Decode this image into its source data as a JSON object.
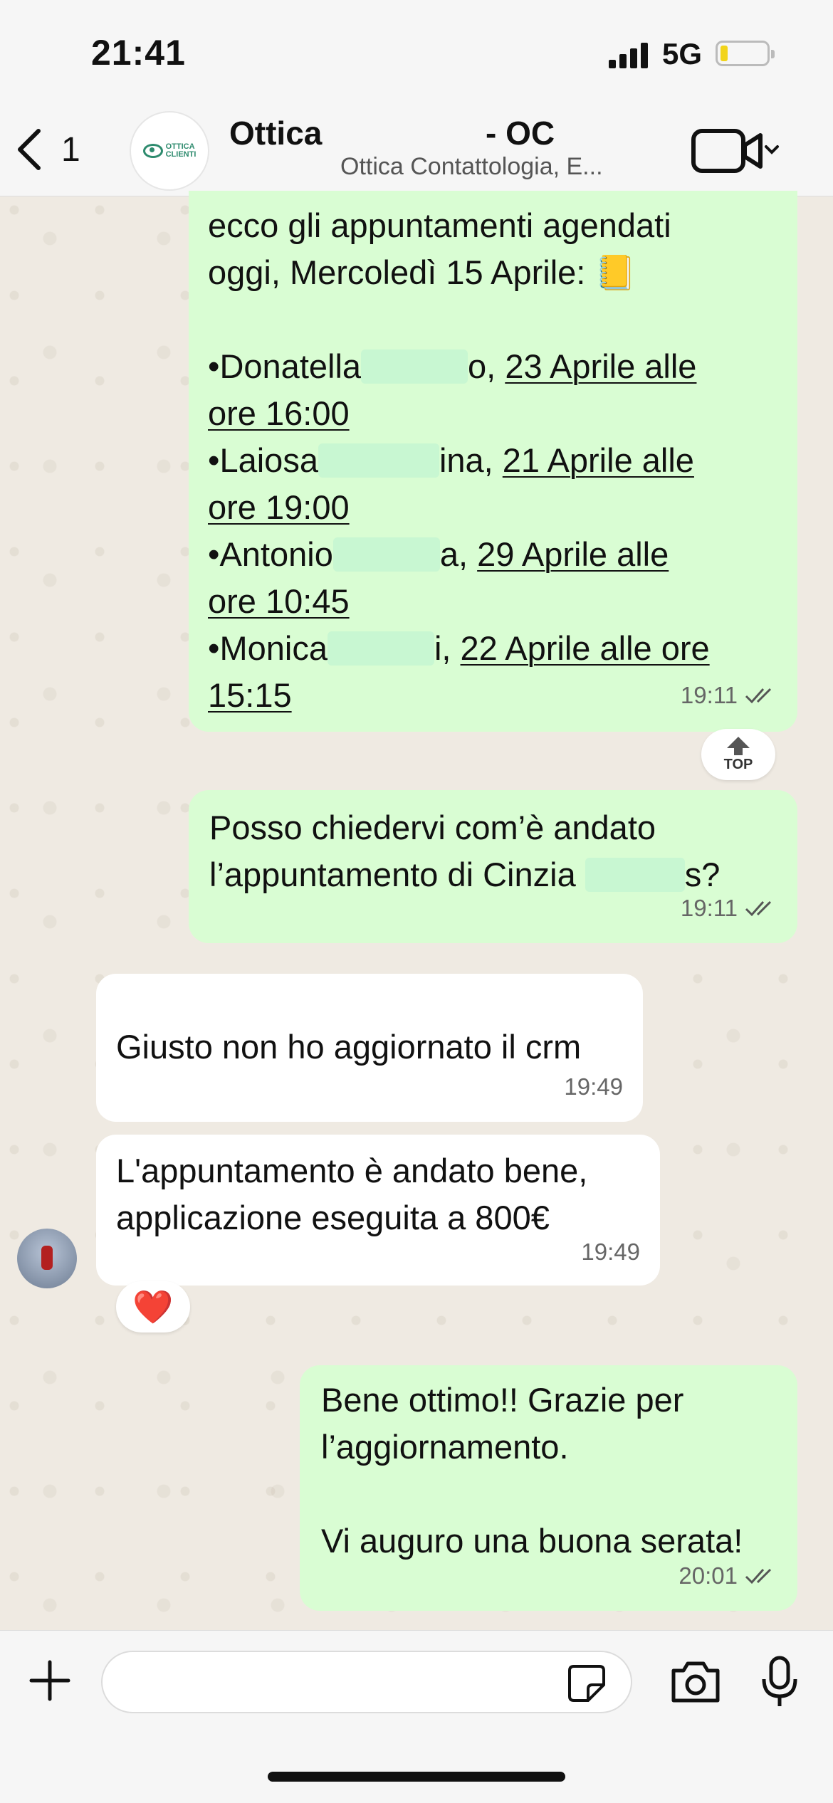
{
  "status_bar": {
    "time": "21:41",
    "network": "5G"
  },
  "header": {
    "back_count": "1",
    "chat_name_part1": "Ottica",
    "chat_name_part2": "- OC",
    "subtitle": "Ottica Contattologia, E...",
    "logo_text_line1": "OTTICA",
    "logo_text_line2": "CLIENTI"
  },
  "messages": [
    {
      "direction": "outgoing",
      "lines": [
        "ecco gli appuntamenti agendati",
        "oggi, Mercoledì 15 Aprile: 📒",
        "",
        "•Donatella",
        "o,",
        "23 Aprile alle",
        "ore 16:00",
        "•Laiosa",
        "ina,",
        "21 Aprile alle",
        "ore 19:00",
        "•Antonio",
        "a,",
        "29 Aprile alle",
        "ore 10:45",
        "•Monica",
        "i,",
        "22 Aprile alle ore",
        "15:15"
      ],
      "time": "19:11"
    },
    {
      "direction": "outgoing",
      "lines": [
        "Posso chiedervi com’è andato",
        "l’appuntamento di Cinzia",
        "s?"
      ],
      "time": "19:11"
    },
    {
      "direction": "incoming",
      "lines": [
        "Giusto non ho aggiornato il crm"
      ],
      "time": "19:49"
    },
    {
      "direction": "incoming",
      "lines": [
        "L'appuntamento è andato bene,",
        "applicazione eseguita a 800€"
      ],
      "time": "19:49",
      "reaction": "❤️"
    },
    {
      "direction": "outgoing",
      "lines": [
        "Bene ottimo!! Grazie per",
        "l’aggiornamento.",
        "",
        "Vi auguro una buona serata!"
      ],
      "time": "20:01"
    }
  ],
  "top_button_label": "TOP",
  "composer": {
    "placeholder": ""
  },
  "colors": {
    "outgoing_bubble": "#d9fdd3",
    "incoming_bubble": "#ffffff",
    "tick_color": "#555555"
  }
}
